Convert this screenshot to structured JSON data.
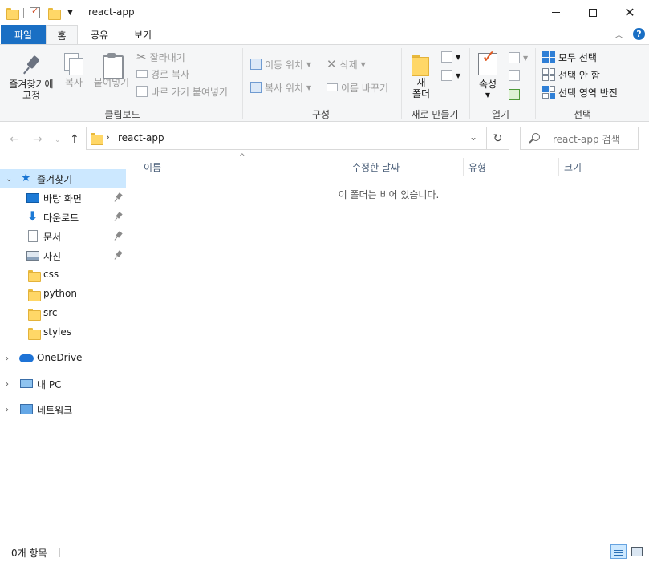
{
  "window": {
    "title": "react-app",
    "icons": [
      "folder-icon",
      "properties-icon",
      "new-folder-icon"
    ]
  },
  "ribbon_tabs": {
    "file": "파일",
    "home": "홈",
    "share": "공유",
    "view": "보기"
  },
  "ribbon": {
    "clipboard": {
      "label": "클립보드",
      "pin": "즐겨찾기에\n고정",
      "pin_line1": "즐겨찾기에",
      "pin_line2": "고정",
      "copy": "복사",
      "paste": "붙여넣기",
      "cut": "잘라내기",
      "copy_path": "경로 복사",
      "paste_shortcut": "바로 가기 붙여넣기"
    },
    "organize": {
      "label": "구성",
      "move_to": "이동 위치",
      "copy_to": "복사 위치",
      "delete": "삭제",
      "rename": "이름 바꾸기"
    },
    "new": {
      "label": "새로 만들기",
      "new_folder_line1": "새",
      "new_folder_line2": "폴더"
    },
    "open": {
      "label": "열기",
      "properties": "속성"
    },
    "select": {
      "label": "선택",
      "select_all": "모두 선택",
      "select_none": "선택 안 함",
      "invert": "선택 영역 반전"
    }
  },
  "address": {
    "path": "react-app",
    "search_placeholder": "react-app 검색"
  },
  "nav": {
    "quick_access": "즐겨찾기",
    "pinned": [
      {
        "label": "바탕 화면",
        "icon": "desktop-icon"
      },
      {
        "label": "다운로드",
        "icon": "download-icon"
      },
      {
        "label": "문서",
        "icon": "documents-icon"
      },
      {
        "label": "사진",
        "icon": "pictures-icon"
      }
    ],
    "folders": [
      {
        "label": "css"
      },
      {
        "label": "python"
      },
      {
        "label": "src"
      },
      {
        "label": "styles"
      }
    ],
    "onedrive": "OneDrive",
    "this_pc": "내 PC",
    "network": "네트워크"
  },
  "columns": {
    "name": "이름",
    "modified": "수정한 날짜",
    "type": "유형",
    "size": "크기"
  },
  "content": {
    "empty_message": "이 폴더는 비어 있습니다."
  },
  "status": {
    "item_count": "0개 항목"
  },
  "colors": {
    "accent": "#1a6fc4",
    "selection": "#cce8ff",
    "folder": "#ffd767"
  }
}
